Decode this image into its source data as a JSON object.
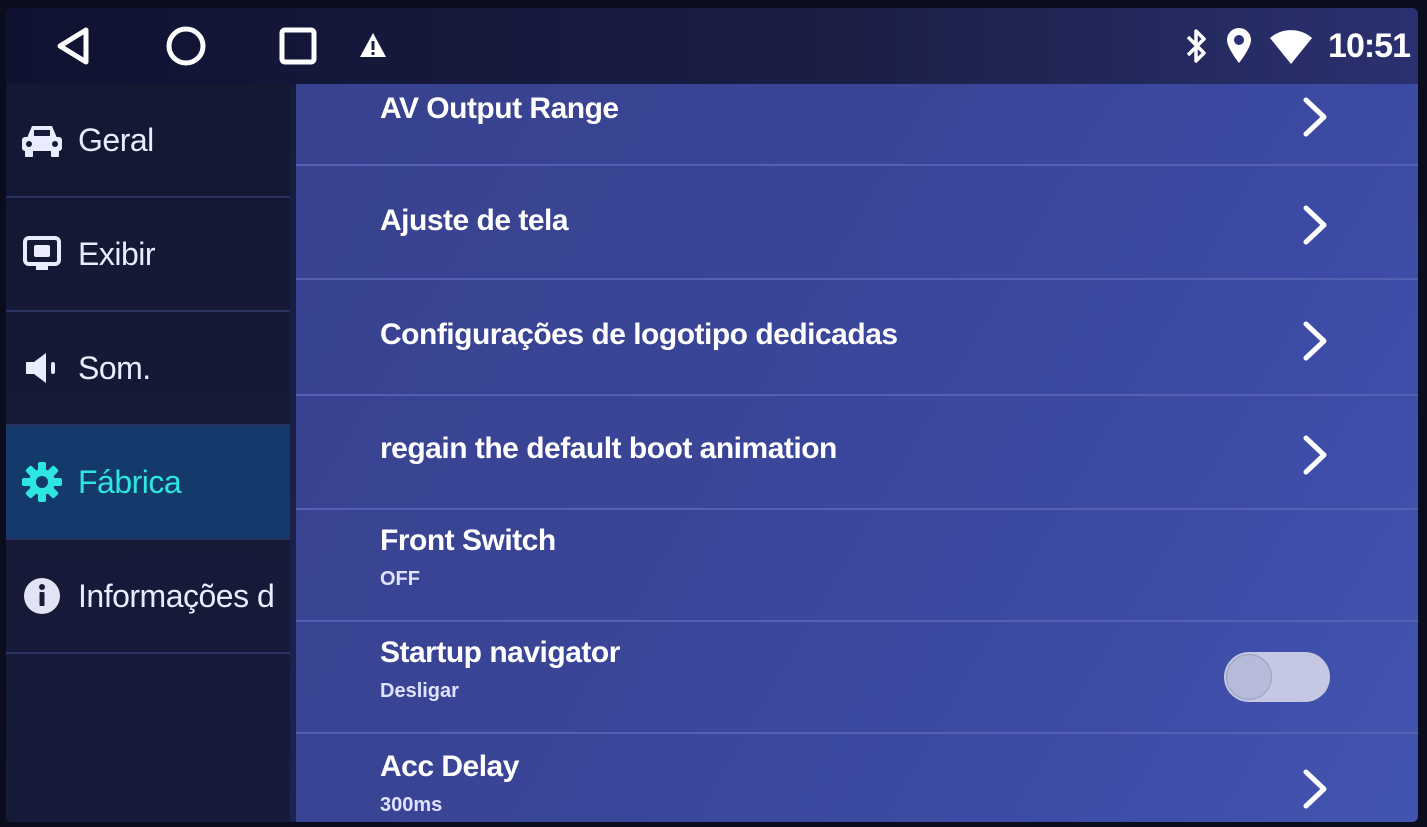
{
  "status": {
    "time": "10:51",
    "icons": [
      "back-icon",
      "home-icon",
      "recent-apps-icon",
      "warning-icon",
      "bluetooth-icon",
      "location-icon",
      "wifi-icon"
    ]
  },
  "sidebar": {
    "items": [
      {
        "label": "Geral",
        "icon": "car-icon",
        "active": false
      },
      {
        "label": "Exibir",
        "icon": "display-icon",
        "active": false
      },
      {
        "label": "Som.",
        "icon": "speaker-icon",
        "active": false
      },
      {
        "label": "Fábrica",
        "icon": "gear-icon",
        "active": true
      },
      {
        "label": "Informações d",
        "icon": "info-icon",
        "active": false
      }
    ]
  },
  "main": {
    "rows": [
      {
        "title": "AV Output Range",
        "type": "chevron"
      },
      {
        "title": "Ajuste de tela",
        "type": "chevron"
      },
      {
        "title": "Configurações de logotipo dedicadas",
        "type": "chevron"
      },
      {
        "title": "regain the default boot animation",
        "type": "chevron"
      },
      {
        "title": "Front Switch",
        "subtitle": "OFF",
        "type": "none"
      },
      {
        "title": "Startup navigator",
        "subtitle": "Desligar",
        "type": "toggle",
        "on": false
      },
      {
        "title": "Acc Delay",
        "subtitle": "300ms",
        "type": "chevron"
      }
    ]
  },
  "colors": {
    "accent": "#2ee6e0",
    "active_bg": "#133a6b",
    "panel_bg": "#3a4597"
  }
}
